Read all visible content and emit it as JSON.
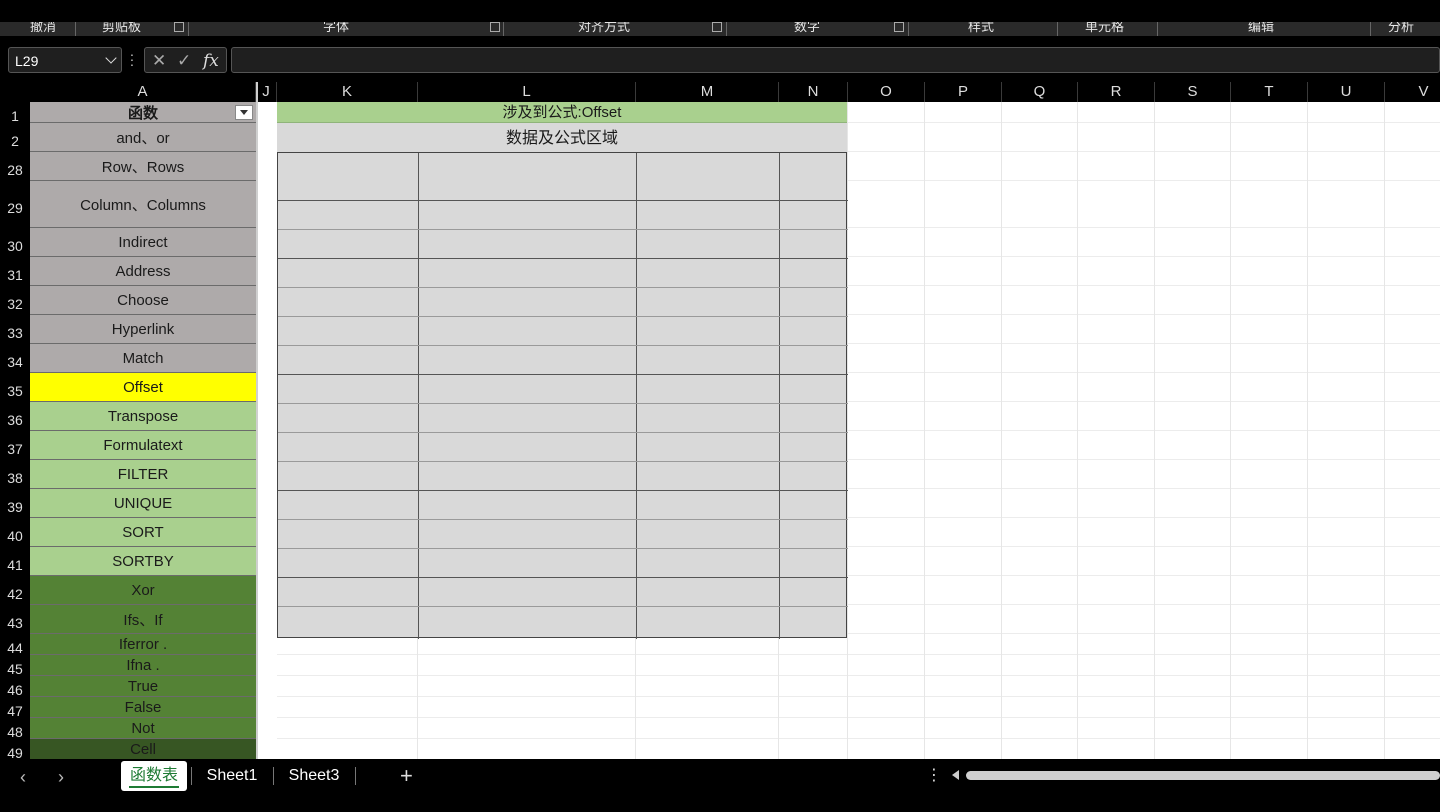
{
  "ribbon": {
    "groups": [
      "撤消",
      "剪贴板",
      "字体",
      "对齐方式",
      "数字",
      "样式",
      "单元格",
      "编辑",
      "分析"
    ]
  },
  "formula_bar": {
    "name_box": "L29",
    "cancel_icon": "✕",
    "enter_icon": "✓",
    "fx_label": "fx",
    "formula": ""
  },
  "columns": [
    "A",
    "J",
    "K",
    "L",
    "M",
    "N",
    "O",
    "P",
    "Q",
    "R",
    "S",
    "T",
    "U",
    "V"
  ],
  "rows": [
    "1",
    "2",
    "28",
    "29",
    "30",
    "31",
    "32",
    "33",
    "34",
    "35",
    "36",
    "37",
    "38",
    "39",
    "40",
    "41",
    "42",
    "43",
    "44",
    "45",
    "46",
    "47",
    "48",
    "49"
  ],
  "column_a": {
    "header": "函数",
    "items": [
      "and、or",
      "Row、Rows",
      "Column、Columns",
      "Indirect",
      "Address",
      "Choose",
      "Hyperlink",
      "Match",
      "Offset",
      "Transpose",
      "Formulatext",
      "FILTER",
      "UNIQUE",
      "SORT",
      "SORTBY",
      "Xor",
      "Ifs、If",
      "Iferror .",
      "Ifna .",
      "True",
      "False",
      "Not",
      "Cell"
    ]
  },
  "content": {
    "title": "涉及到公式:Offset",
    "subtitle": "数据及公式区域"
  },
  "colors": {
    "gray": "#aeaaaa",
    "yellow": "#ffff00",
    "light_green": "#a9d08e",
    "dark_green": "#548235",
    "darker_green": "#375623",
    "header_gray": "#d9d9d9"
  },
  "sheets": {
    "tabs": [
      "函数表",
      "Sheet1",
      "Sheet3"
    ],
    "active": "函数表",
    "add_label": "+",
    "more_label": "⋮"
  }
}
